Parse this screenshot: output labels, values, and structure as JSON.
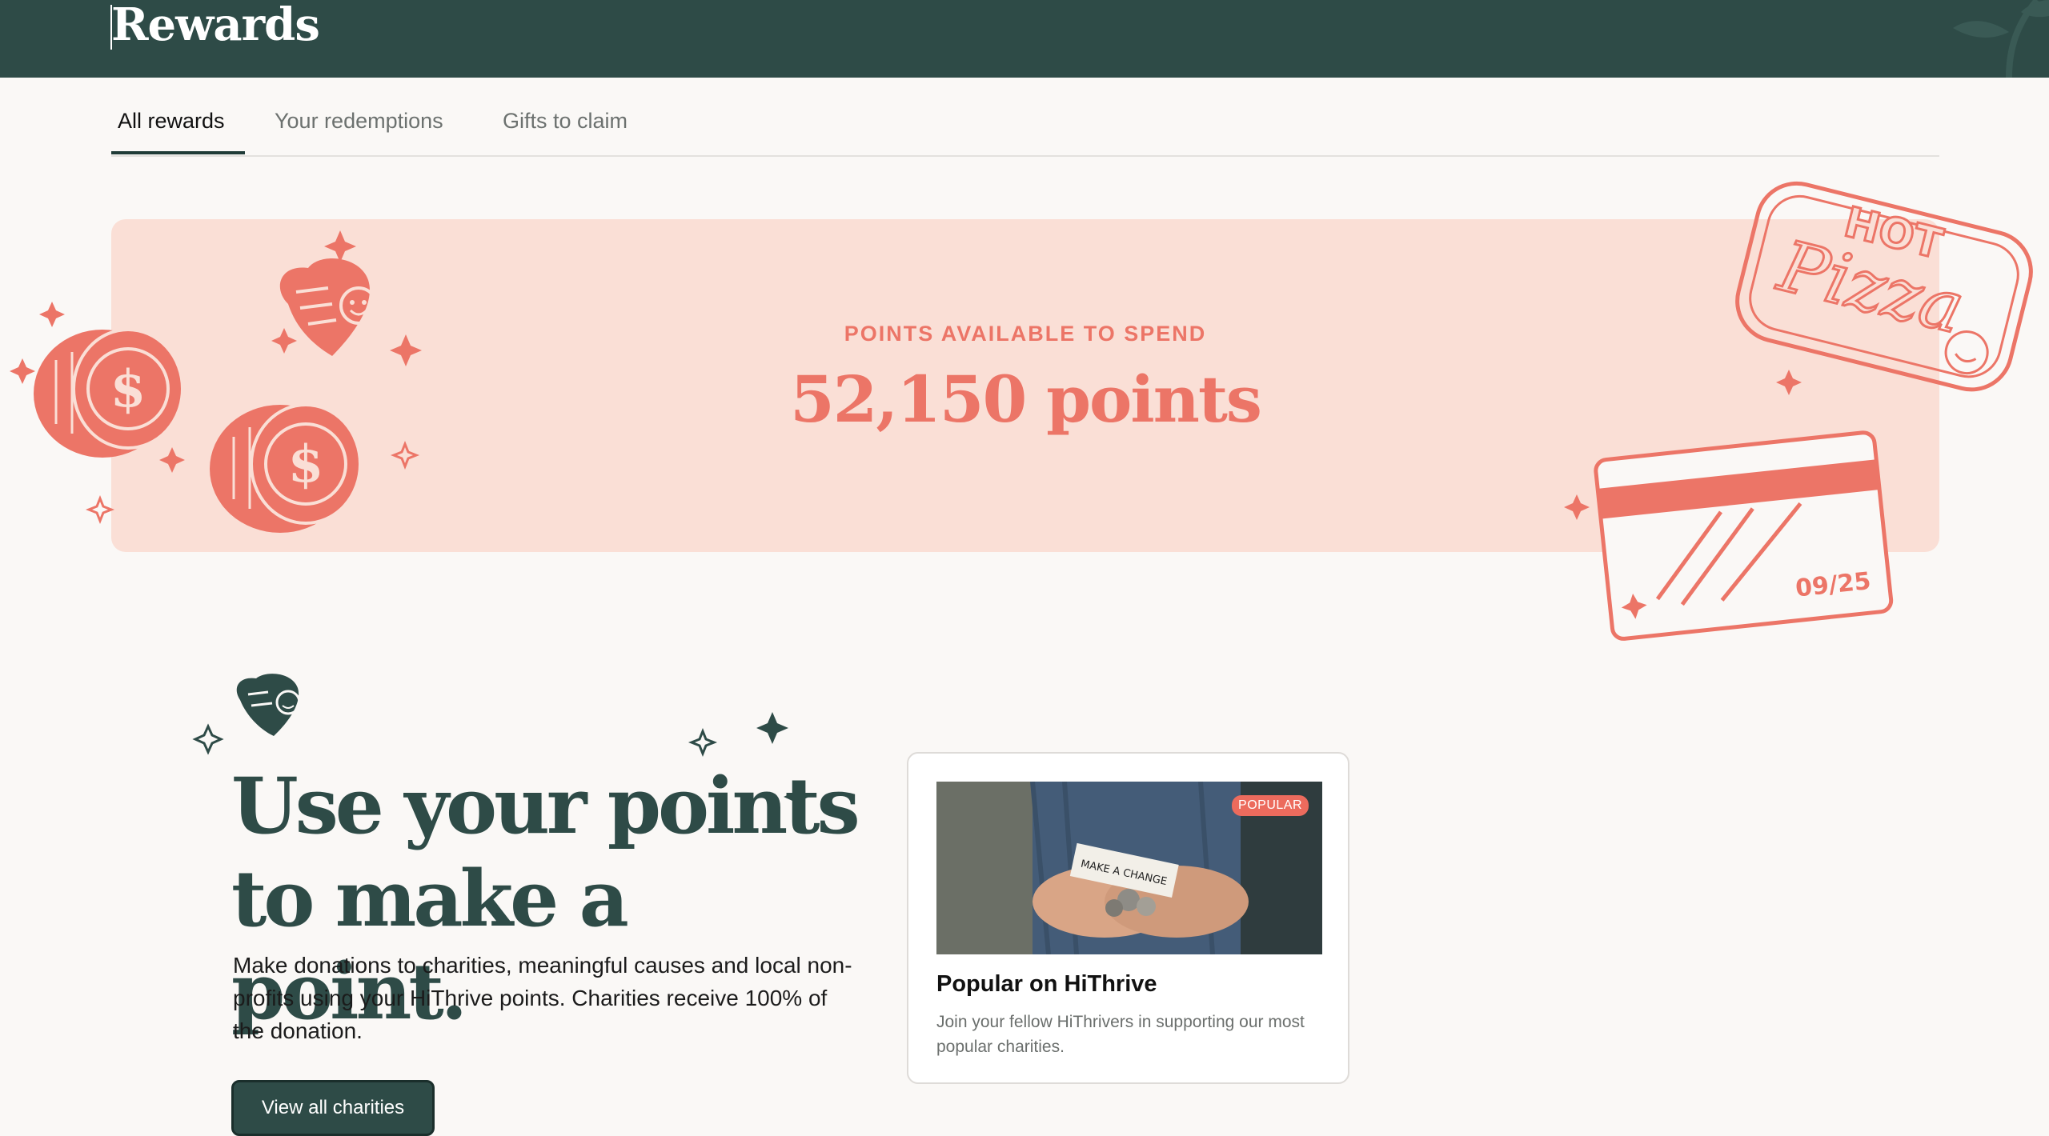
{
  "header": {
    "title": "Rewards"
  },
  "tabs": [
    {
      "label": "All rewards",
      "active": true
    },
    {
      "label": "Your redemptions",
      "active": false
    },
    {
      "label": "Gifts to claim",
      "active": false
    }
  ],
  "points": {
    "label": "POINTS AVAILABLE TO SPEND",
    "value": "52,150 points"
  },
  "stickers": {
    "pizza_text_1": "HOT",
    "pizza_text_2": "Pizza",
    "card_expiry": "09/25"
  },
  "charity": {
    "title_line1": "Use your points",
    "title_line2": "to make a point.",
    "description": "Make donations to charities, meaningful causes and local non-profits using your HiThrive points. Charities receive 100% of the donation.",
    "button_label": "View all charities"
  },
  "popular_card": {
    "badge": "POPULAR",
    "title": "Popular on HiThrive",
    "description": "Join your fellow HiThrivers in supporting our most popular charities.",
    "photo_note": "MAKE A CHANGE"
  },
  "colors": {
    "header_bg": "#2e4b47",
    "accent": "#ec7567",
    "banner_bg": "#fadfd6",
    "button_bg": "#2e4b47"
  }
}
